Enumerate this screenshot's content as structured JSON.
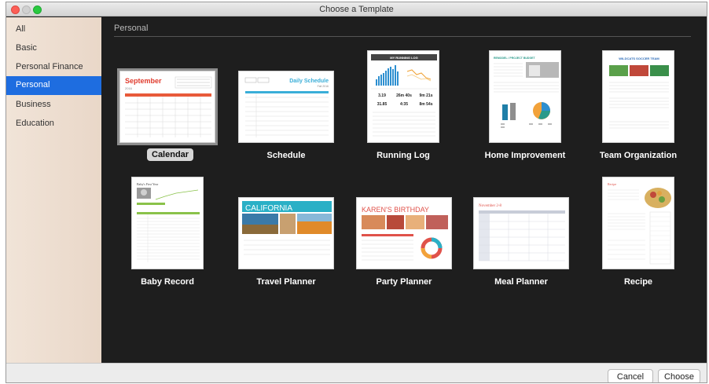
{
  "window": {
    "title": "Choose a Template"
  },
  "sidebar": {
    "items": [
      {
        "label": "All"
      },
      {
        "label": "Basic"
      },
      {
        "label": "Personal Finance"
      },
      {
        "label": "Personal",
        "selected": true
      },
      {
        "label": "Business"
      },
      {
        "label": "Education"
      }
    ]
  },
  "content": {
    "section_title": "Personal",
    "templates": [
      {
        "label": "Calendar",
        "selected": true,
        "thumb": {
          "month": "September",
          "year": "2016"
        }
      },
      {
        "label": "Schedule",
        "thumb": {
          "heading": "Daily Schedule",
          "date": "Fall 2016"
        }
      },
      {
        "label": "Running Log",
        "thumb": {
          "heading": "MY RUNNING LOG",
          "stats": [
            "3.19",
            "26m 40s",
            "9m 21s",
            "31.85",
            "4:35",
            "8m 54s"
          ]
        }
      },
      {
        "label": "Home Improvement",
        "thumb": {
          "heading": "REMODEL / PROJECT BUDGET"
        }
      },
      {
        "label": "Team Organization",
        "thumb": {
          "heading": "WILDCATS SOCCER TEAM"
        }
      },
      {
        "label": "Baby Record",
        "thumb": {
          "heading": "Baby's First Year"
        }
      },
      {
        "label": "Travel Planner",
        "thumb": {
          "heading": "CALIFORNIA"
        }
      },
      {
        "label": "Party Planner",
        "thumb": {
          "heading": "KAREN'S BIRTHDAY"
        }
      },
      {
        "label": "Meal Planner",
        "thumb": {
          "heading": "November 2-8"
        }
      },
      {
        "label": "Recipe",
        "thumb": {
          "heading": "Recipe"
        }
      }
    ]
  },
  "buttons": {
    "cancel": "Cancel",
    "choose": "Choose"
  },
  "colors": {
    "selection_blue": "#1e6de0",
    "content_bg": "#1e1e1e",
    "sidebar_bg": "#efe2d6"
  }
}
